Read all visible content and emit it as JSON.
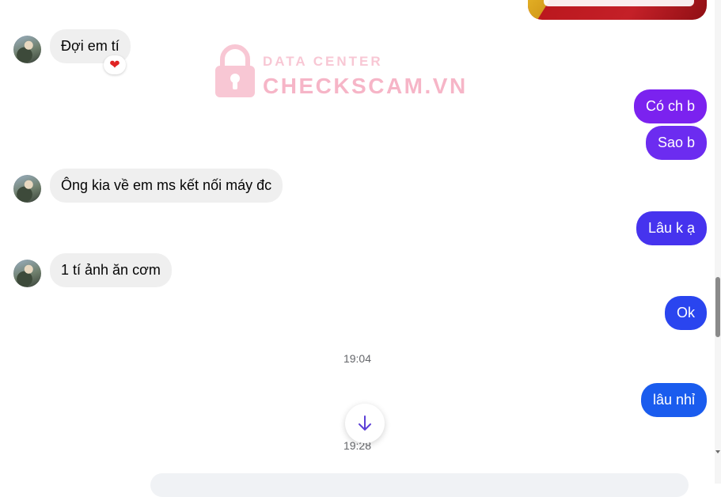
{
  "colors": {
    "incoming_bg": "#efefef",
    "outgoing_purple": "#7b22ef",
    "outgoing_violet": "#6c2cf0",
    "outgoing_indigo": "#4633ee",
    "outgoing_blue": "#2a45ef",
    "outgoing_bright_blue": "#1a5cee"
  },
  "watermark": {
    "line1": "DATA CENTER",
    "line2": "CHECKSCAM.VN",
    "icon": "lock-icon"
  },
  "messages": {
    "m1": {
      "text": "Đợi em tí",
      "reaction": "❤"
    },
    "m2": {
      "text": "Có ch b"
    },
    "m3": {
      "text": "Sao b"
    },
    "m4": {
      "text": "Ông kia về em ms kết nối máy đc"
    },
    "m5": {
      "text": "Lâu k ạ"
    },
    "m6": {
      "text": "1 tí ảnh ăn cơm"
    },
    "m7": {
      "text": "Ok"
    },
    "m8": {
      "text": "lâu nhỉ"
    }
  },
  "timestamps": {
    "t1": "19:04",
    "t2": "19:28"
  },
  "controls": {
    "scroll_down_icon": "arrow-down-icon"
  }
}
